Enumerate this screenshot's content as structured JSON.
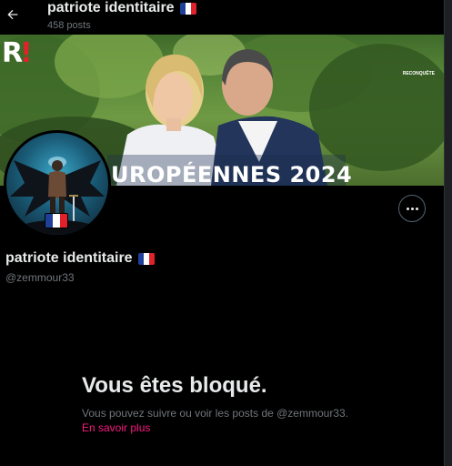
{
  "header": {
    "title": "patriote identitaire",
    "posts_count": "458 posts"
  },
  "banner": {
    "text": "UROPÉENNES 2024",
    "logo_letter": "R!",
    "logo_caption": "RECONQUÊTE"
  },
  "profile": {
    "display_name": "patriote identitaire",
    "handle": "@zemmour33"
  },
  "blocked": {
    "title": "Vous êtes bloqué.",
    "message": "Vous pouvez suivre ou voir les posts de @zemmour33.",
    "link": "En savoir plus"
  },
  "icons": {
    "back": "arrow-left-icon",
    "more": "more-horizontal-icon",
    "flag": "french-flag-icon"
  },
  "colors": {
    "background": "#000000",
    "text_primary": "#e7e9ea",
    "text_secondary": "#71767b",
    "link": "#f91880",
    "flag_blue": "#1f3f99",
    "flag_white": "#ffffff",
    "flag_red": "#e1222b"
  }
}
